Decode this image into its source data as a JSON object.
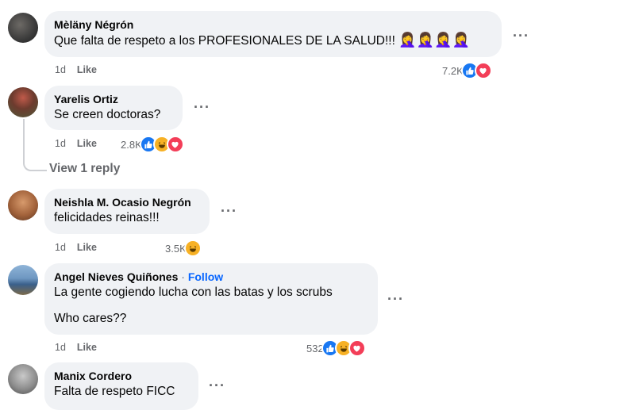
{
  "comments": [
    {
      "author": "Mèläny Négrón",
      "text": "Que falta de respeto a los PROFESIONALES DE LA SALUD!!!",
      "emojis": "🤦‍♀️🤦‍♀️🤦‍♀️🤦‍♀️",
      "time": "1d",
      "like": "Like",
      "reaction_count": "7.2K",
      "reactions": [
        "like",
        "love"
      ]
    },
    {
      "author": "Yarelis Ortiz",
      "text": "Se creen doctoras?",
      "time": "1d",
      "like": "Like",
      "reaction_count": "2.8K",
      "reactions": [
        "like",
        "haha",
        "love"
      ],
      "view_replies": "View 1 reply"
    },
    {
      "author": "Neishla M. Ocasio Negrón",
      "text": "felicidades reinas!!!",
      "time": "1d",
      "like": "Like",
      "reaction_count": "3.5K",
      "reactions": [
        "haha"
      ]
    },
    {
      "author": "Angel Nieves Quiñones",
      "separator": "·",
      "follow": "Follow",
      "text": "La gente cogiendo lucha con las batas y los scrubs",
      "text2": "Who cares??",
      "time": "1d",
      "like": "Like",
      "reaction_count": "532",
      "reactions": [
        "like",
        "haha",
        "love"
      ]
    },
    {
      "author": "Manix Cordero",
      "text": "Falta de respeto FICC"
    }
  ],
  "more_label": "···",
  "colors": {
    "bubble": "#f0f2f5",
    "link": "#0866ff",
    "muted": "#65676b",
    "like": "#1877f2",
    "love": "#f33e58",
    "haha": "#f7b125"
  },
  "icons": {
    "like": "thumbs-up-icon",
    "love": "heart-icon",
    "haha": "laughing-face-icon"
  }
}
